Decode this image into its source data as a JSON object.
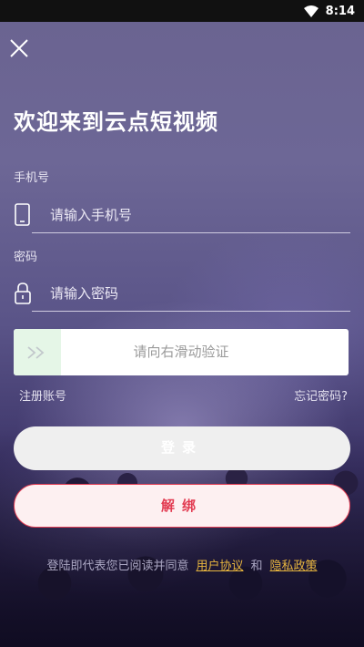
{
  "status_bar": {
    "time": "8:14",
    "icons": [
      "wifi-icon",
      "battery-icon"
    ]
  },
  "header": {
    "close_icon": "close-icon",
    "title": "欢迎来到云点短视频"
  },
  "phone": {
    "label": "手机号",
    "placeholder": "请输入手机号",
    "icon": "phone-icon"
  },
  "password": {
    "label": "密码",
    "placeholder": "请输入密码",
    "icon": "lock-icon"
  },
  "slider": {
    "text": "请向右滑动验证",
    "handle_icon": "double-chevron-right-icon"
  },
  "links": {
    "register": "注册账号",
    "forgot": "忘记密码?"
  },
  "buttons": {
    "login": "登录",
    "unbind": "解绑"
  },
  "agreement": {
    "prefix": "登陆即代表您已阅读并同意",
    "user_agreement": "用户协议",
    "and": "和",
    "privacy_policy": "隐私政策"
  },
  "colors": {
    "accent": "#e23c52",
    "link": "#e6b43e"
  }
}
